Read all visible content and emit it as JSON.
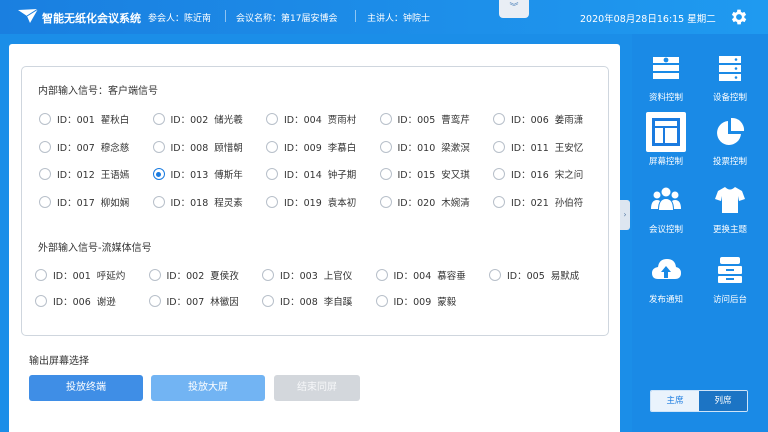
{
  "header": {
    "app_title": "智能无纸化会议系统",
    "participant": "参会人：陈近南",
    "meeting_name": "会议名称：第17届安博会",
    "speaker": "主讲人：钟院士",
    "datetime": "2020年08月28日16:15 星期二",
    "collapse_icon": "chevron-double-down-icon",
    "settings_icon": "gear-icon"
  },
  "internal": {
    "label": "内部输入信号：客户端信号",
    "signals": [
      {
        "id": "ID：001",
        "name": "翟秋白",
        "selected": false
      },
      {
        "id": "ID：002",
        "name": "储光羲",
        "selected": false
      },
      {
        "id": "ID：004",
        "name": "贾雨村",
        "selected": false
      },
      {
        "id": "ID：005",
        "name": "曹鸾芹",
        "selected": false
      },
      {
        "id": "ID：006",
        "name": "姜雨潇",
        "selected": false
      },
      {
        "id": "ID：007",
        "name": "穆念慈",
        "selected": false
      },
      {
        "id": "ID：008",
        "name": "顾惜朝",
        "selected": false
      },
      {
        "id": "ID：009",
        "name": "李慕白",
        "selected": false
      },
      {
        "id": "ID：010",
        "name": "梁漱溟",
        "selected": false
      },
      {
        "id": "ID：011",
        "name": "王安忆",
        "selected": false
      },
      {
        "id": "ID：012",
        "name": "王语嫣",
        "selected": false
      },
      {
        "id": "ID：013",
        "name": "傅斯年",
        "selected": true
      },
      {
        "id": "ID：014",
        "name": "钟子期",
        "selected": false
      },
      {
        "id": "ID：015",
        "name": "安又琪",
        "selected": false
      },
      {
        "id": "ID：016",
        "name": "宋之问",
        "selected": false
      },
      {
        "id": "ID：017",
        "name": "柳如娴",
        "selected": false
      },
      {
        "id": "ID：018",
        "name": "程灵素",
        "selected": false
      },
      {
        "id": "ID：019",
        "name": "袁本初",
        "selected": false
      },
      {
        "id": "ID：020",
        "name": "木婉清",
        "selected": false
      },
      {
        "id": "ID：021",
        "name": "孙伯符",
        "selected": false
      }
    ]
  },
  "external": {
    "label": "外部输入信号-流媒体信号",
    "signals": [
      {
        "id": "ID：001",
        "name": "呼延灼",
        "selected": false
      },
      {
        "id": "ID：002",
        "name": "夏侯孜",
        "selected": false
      },
      {
        "id": "ID：003",
        "name": "上官仪",
        "selected": false
      },
      {
        "id": "ID：004",
        "name": "慕容垂",
        "selected": false
      },
      {
        "id": "ID：005",
        "name": "易默成",
        "selected": false
      },
      {
        "id": "ID：006",
        "name": "谢逊",
        "selected": false
      },
      {
        "id": "ID：007",
        "name": "林徽因",
        "selected": false
      },
      {
        "id": "ID：008",
        "name": "李自蹊",
        "selected": false
      },
      {
        "id": "ID：009",
        "name": "蒙毅",
        "selected": false
      }
    ]
  },
  "output": {
    "label": "输出屏幕选择",
    "buttons": [
      "投放终端",
      "投放大屏",
      "结束同屏"
    ]
  },
  "sidebar": {
    "items": [
      {
        "label": "资料控制",
        "icon": "document-control-icon",
        "active": false
      },
      {
        "label": "设备控制",
        "icon": "server-icon",
        "active": false
      },
      {
        "label": "屏幕控制",
        "icon": "screen-layout-icon",
        "active": true
      },
      {
        "label": "投票控制",
        "icon": "pie-chart-icon",
        "active": false
      },
      {
        "label": "会议控制",
        "icon": "people-icon",
        "active": false
      },
      {
        "label": "更换主题",
        "icon": "shirt-icon",
        "active": false
      },
      {
        "label": "发布通知",
        "icon": "cloud-upload-icon",
        "active": false
      },
      {
        "label": "访问后台",
        "icon": "database-icon",
        "active": false
      }
    ],
    "toggle": {
      "main": "主席",
      "list": "列席"
    }
  },
  "colors": {
    "accent": "#1a7be0",
    "sidebar": "#1a8ae6",
    "header": "#1f90ea"
  }
}
